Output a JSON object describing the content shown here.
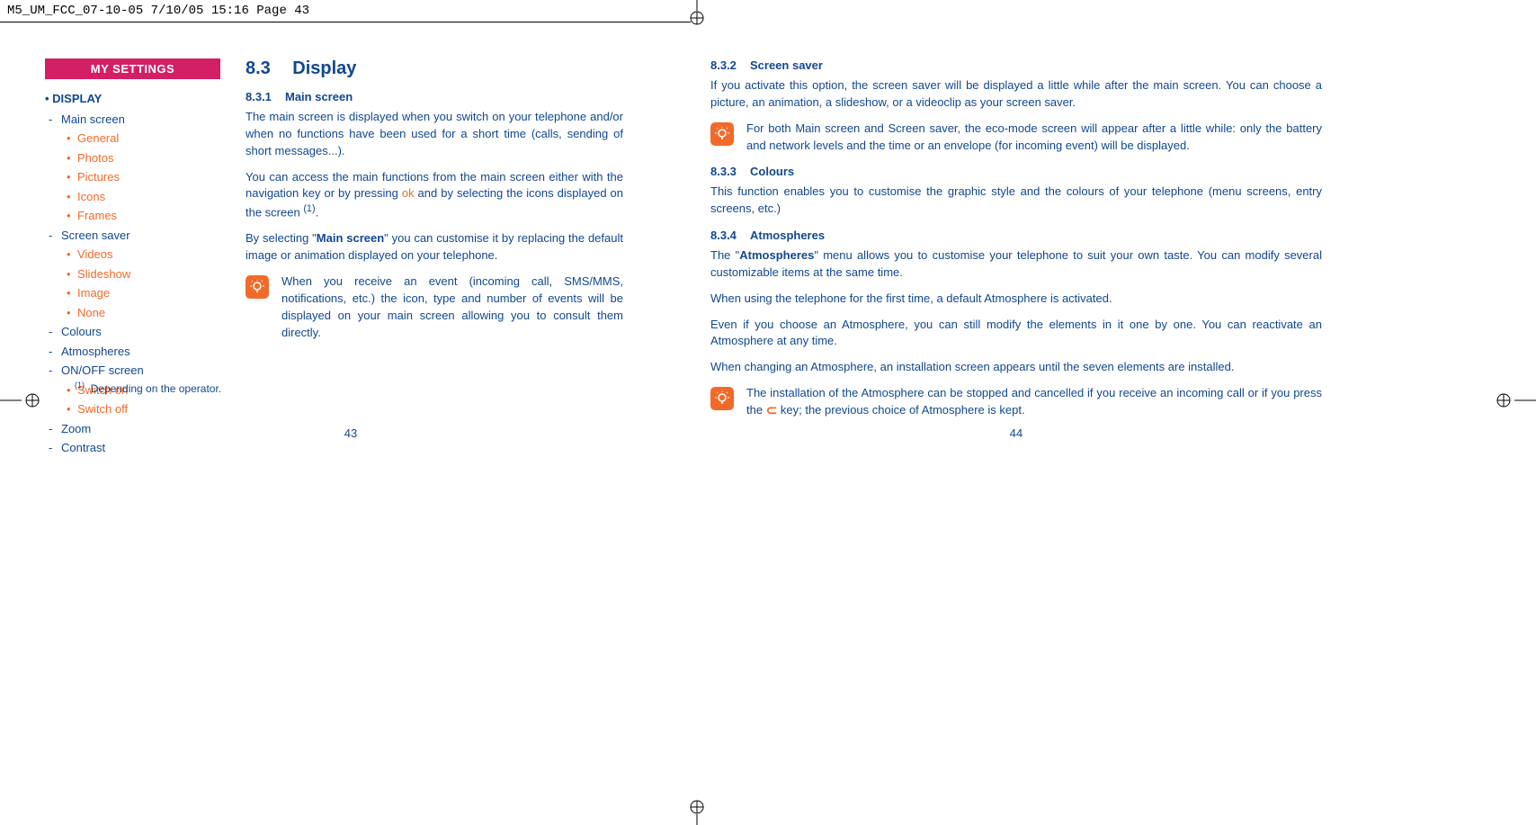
{
  "header": {
    "slug": "M5_UM_FCC_07-10-05  7/10/05  15:16  Page 43"
  },
  "nav": {
    "title": "MY SETTINGS",
    "root": "DISPLAY",
    "items": [
      {
        "label": "Main screen",
        "children": [
          "General",
          "Photos",
          "Pictures",
          "Icons",
          "Frames"
        ]
      },
      {
        "label": "Screen saver",
        "children": [
          "Videos",
          "Slideshow",
          "Image",
          "None"
        ]
      },
      {
        "label": "Colours"
      },
      {
        "label": "Atmospheres"
      },
      {
        "label": "ON/OFF screen",
        "children": [
          "Switch on",
          "Switch off"
        ]
      },
      {
        "label": "Zoom"
      },
      {
        "label": "Contrast"
      }
    ]
  },
  "left": {
    "sec_num": "8.3",
    "sec_title": "Display",
    "s1_num": "8.3.1",
    "s1_title": "Main screen",
    "p1": "The main screen is displayed when you switch on your telephone and/or when no functions have been used for a short time (calls, sending of short messages...).",
    "p2a": "You can access the main functions from the main screen either with the navigation key or by pressing ",
    "p2_ok": "ok",
    "p2b": " and by selecting the icons displayed on the screen ",
    "p2_foot": "(1)",
    "p2c": ".",
    "p3a": "By selecting \"",
    "p3_bold": "Main screen",
    "p3b": "\" you can customise it by replacing the default image or animation displayed on your telephone.",
    "tip1": "When you receive an event (incoming call, SMS/MMS, notifications, etc.) the icon, type and number of events will be displayed on your main screen allowing you to consult them directly.",
    "footnote_mark": "(1)",
    "footnote": "Depending on the operator.",
    "page_num": "43"
  },
  "right": {
    "s2_num": "8.3.2",
    "s2_title": "Screen saver",
    "p4": "If you activate this option, the screen saver will be displayed a little while after the main screen. You can choose a picture, an animation, a slideshow, or a videoclip as your screen saver.",
    "tip2": "For both Main screen and Screen saver, the eco-mode screen will appear after a little while: only the battery and network levels and the time or an envelope (for incoming event) will be displayed.",
    "s3_num": "8.3.3",
    "s3_title": "Colours",
    "p5": "This function enables you to customise the graphic style and the colours of your telephone (menu screens, entry screens, etc.)",
    "s4_num": "8.3.4",
    "s4_title": "Atmospheres",
    "p6a": "The \"",
    "p6_bold": "Atmospheres",
    "p6b": "\" menu allows you to customise your telephone to suit your own taste. You can modify several customizable items at the same time.",
    "p7": "When using the telephone for the first time, a default Atmosphere is activated.",
    "p8": "Even if you choose an Atmosphere, you can still modify the elements in it one by one. You can reactivate an Atmosphere at any time.",
    "p9": "When changing an Atmosphere, an installation screen appears until the seven elements are installed.",
    "tip3a": "The installation of the Atmosphere can be stopped and cancelled if you receive an incoming call or if you press the ",
    "tip3b": " key; the previous choice of Atmosphere is kept.",
    "page_num": "44"
  }
}
